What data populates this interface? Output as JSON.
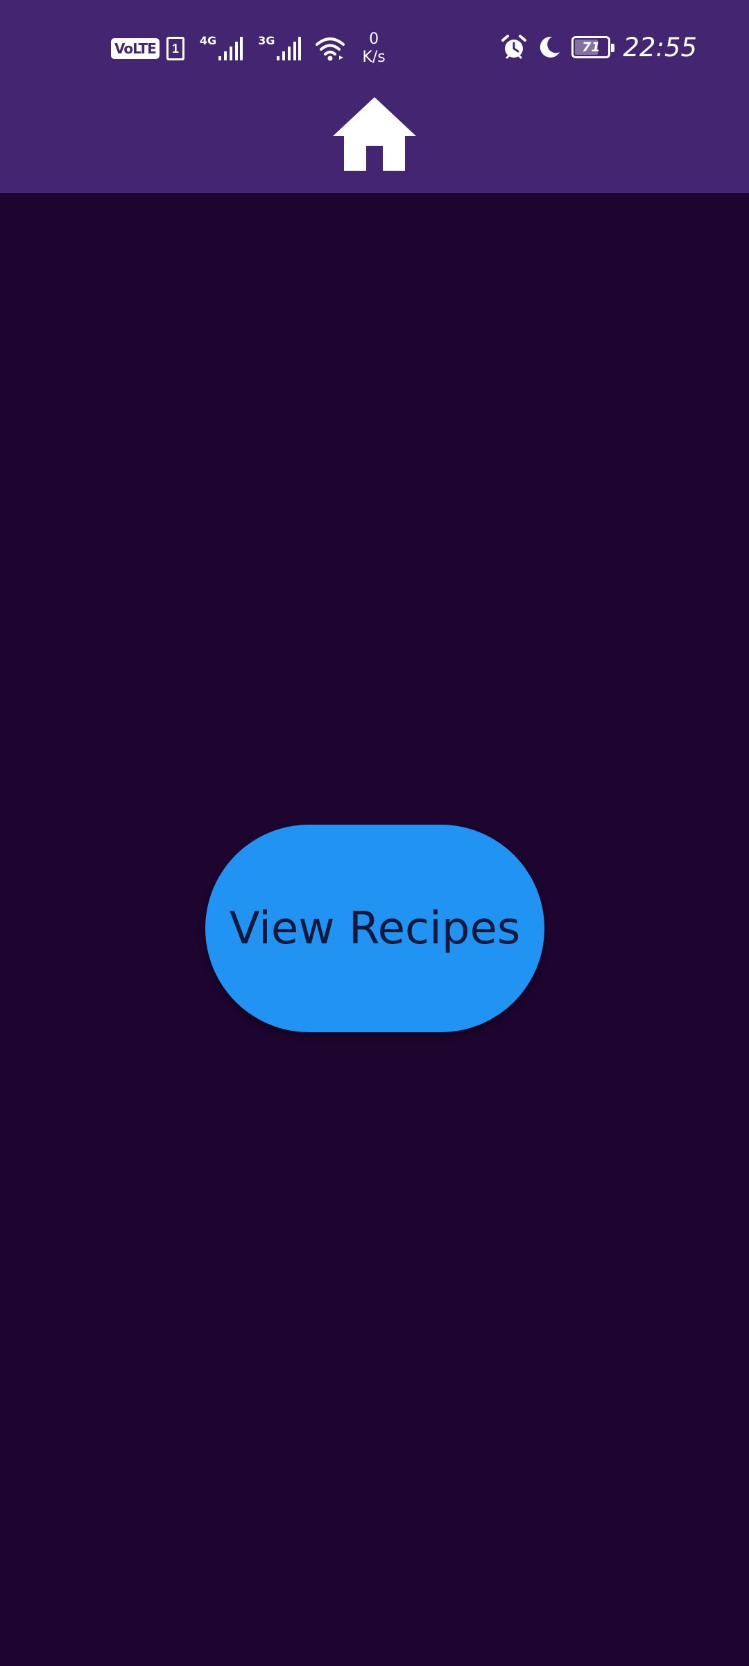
{
  "status_bar": {
    "volte_label": "VoLTE",
    "sim_label": "1",
    "network_1": "4G",
    "network_2": "3G",
    "speed_value": "0",
    "speed_unit": "K/s",
    "battery_level": "71",
    "battery_percent": 71,
    "time": "22:55",
    "icons": [
      "volte-icon",
      "sim-icon",
      "signal-icon",
      "signal-icon",
      "wifi-icon",
      "alarm-icon",
      "moon-icon",
      "battery-icon"
    ]
  },
  "header": {
    "icon": "home-icon",
    "background": "#432571"
  },
  "main": {
    "background": "#1e0530",
    "button_label": "View Recipes",
    "button_color": "#2194f3"
  }
}
